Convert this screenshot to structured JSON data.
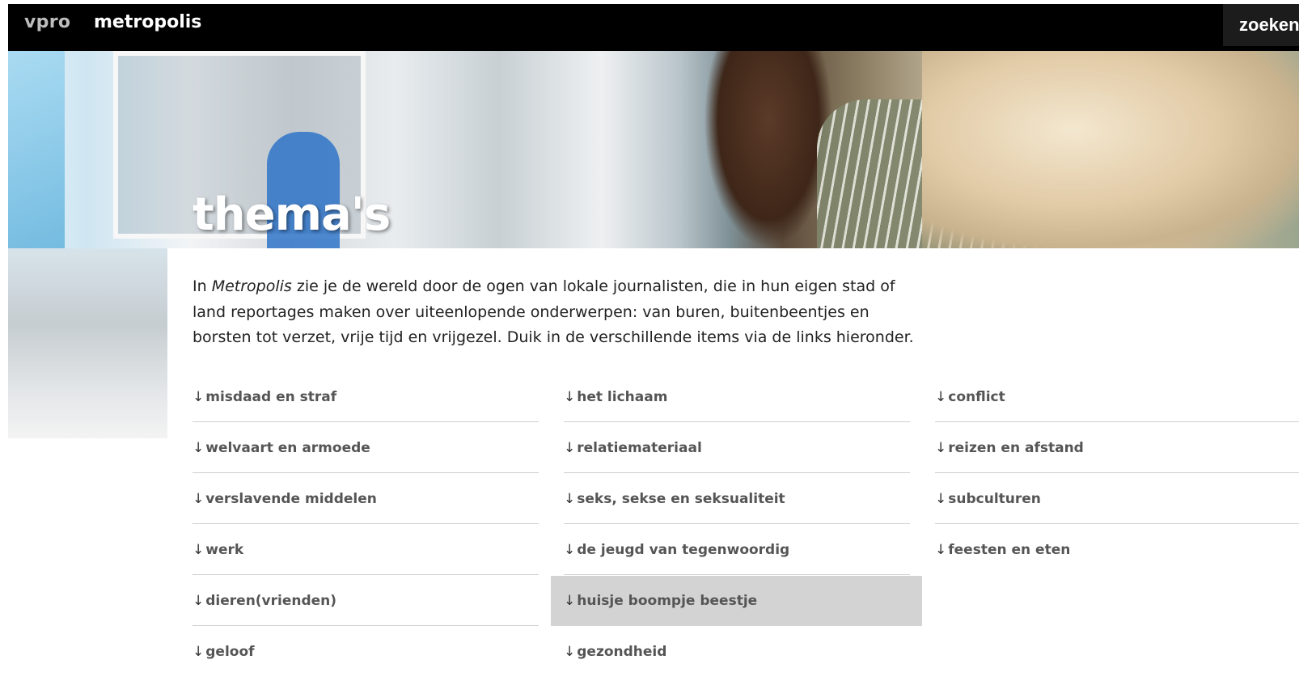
{
  "nav": {
    "brand": "vpro",
    "site": "metropolis",
    "search_label": "zoeken"
  },
  "hero": {
    "title": "thema's"
  },
  "intro": {
    "italic": "Metropolis",
    "before": "In ",
    "after": " zie je de wereld door de ogen van lokale journalisten, die in hun eigen stad of land reportages maken over uiteenlopende onderwerpen: van buren, buitenbeentjes en borsten tot verzet, vrije tijd en vrijgezel. Duik in de verschillende items via de links hieronder."
  },
  "arrow": "↓",
  "themes": {
    "col1": [
      "misdaad en straf",
      "welvaart en armoede",
      "verslavende middelen",
      "werk",
      "dieren(vrienden)",
      "geloof"
    ],
    "col2": [
      "het lichaam",
      "relatiemateriaal",
      "seks, sekse en seksualiteit",
      "de jeugd van tegenwoordig",
      "huisje boompje beestje",
      "gezondheid"
    ],
    "col3": [
      "conflict",
      "reizen en afstand",
      "subculturen",
      "feesten en eten"
    ]
  },
  "colors": {
    "nav_bg": "#000000",
    "highlight_bg": "#d3d3d3",
    "link_text": "#555555"
  }
}
